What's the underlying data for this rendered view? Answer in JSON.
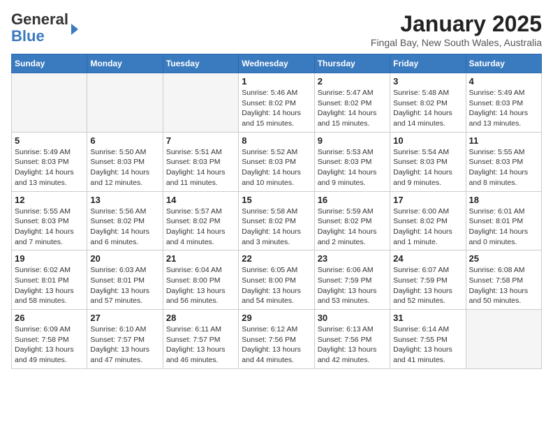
{
  "header": {
    "logo_line1": "General",
    "logo_line2": "Blue",
    "month_title": "January 2025",
    "location": "Fingal Bay, New South Wales, Australia"
  },
  "calendar": {
    "days_of_week": [
      "Sunday",
      "Monday",
      "Tuesday",
      "Wednesday",
      "Thursday",
      "Friday",
      "Saturday"
    ],
    "weeks": [
      [
        {
          "day": "",
          "info": ""
        },
        {
          "day": "",
          "info": ""
        },
        {
          "day": "",
          "info": ""
        },
        {
          "day": "1",
          "info": "Sunrise: 5:46 AM\nSunset: 8:02 PM\nDaylight: 14 hours\nand 15 minutes."
        },
        {
          "day": "2",
          "info": "Sunrise: 5:47 AM\nSunset: 8:02 PM\nDaylight: 14 hours\nand 15 minutes."
        },
        {
          "day": "3",
          "info": "Sunrise: 5:48 AM\nSunset: 8:02 PM\nDaylight: 14 hours\nand 14 minutes."
        },
        {
          "day": "4",
          "info": "Sunrise: 5:49 AM\nSunset: 8:03 PM\nDaylight: 14 hours\nand 13 minutes."
        }
      ],
      [
        {
          "day": "5",
          "info": "Sunrise: 5:49 AM\nSunset: 8:03 PM\nDaylight: 14 hours\nand 13 minutes."
        },
        {
          "day": "6",
          "info": "Sunrise: 5:50 AM\nSunset: 8:03 PM\nDaylight: 14 hours\nand 12 minutes."
        },
        {
          "day": "7",
          "info": "Sunrise: 5:51 AM\nSunset: 8:03 PM\nDaylight: 14 hours\nand 11 minutes."
        },
        {
          "day": "8",
          "info": "Sunrise: 5:52 AM\nSunset: 8:03 PM\nDaylight: 14 hours\nand 10 minutes."
        },
        {
          "day": "9",
          "info": "Sunrise: 5:53 AM\nSunset: 8:03 PM\nDaylight: 14 hours\nand 9 minutes."
        },
        {
          "day": "10",
          "info": "Sunrise: 5:54 AM\nSunset: 8:03 PM\nDaylight: 14 hours\nand 9 minutes."
        },
        {
          "day": "11",
          "info": "Sunrise: 5:55 AM\nSunset: 8:03 PM\nDaylight: 14 hours\nand 8 minutes."
        }
      ],
      [
        {
          "day": "12",
          "info": "Sunrise: 5:55 AM\nSunset: 8:03 PM\nDaylight: 14 hours\nand 7 minutes."
        },
        {
          "day": "13",
          "info": "Sunrise: 5:56 AM\nSunset: 8:02 PM\nDaylight: 14 hours\nand 6 minutes."
        },
        {
          "day": "14",
          "info": "Sunrise: 5:57 AM\nSunset: 8:02 PM\nDaylight: 14 hours\nand 4 minutes."
        },
        {
          "day": "15",
          "info": "Sunrise: 5:58 AM\nSunset: 8:02 PM\nDaylight: 14 hours\nand 3 minutes."
        },
        {
          "day": "16",
          "info": "Sunrise: 5:59 AM\nSunset: 8:02 PM\nDaylight: 14 hours\nand 2 minutes."
        },
        {
          "day": "17",
          "info": "Sunrise: 6:00 AM\nSunset: 8:02 PM\nDaylight: 14 hours\nand 1 minute."
        },
        {
          "day": "18",
          "info": "Sunrise: 6:01 AM\nSunset: 8:01 PM\nDaylight: 14 hours\nand 0 minutes."
        }
      ],
      [
        {
          "day": "19",
          "info": "Sunrise: 6:02 AM\nSunset: 8:01 PM\nDaylight: 13 hours\nand 58 minutes."
        },
        {
          "day": "20",
          "info": "Sunrise: 6:03 AM\nSunset: 8:01 PM\nDaylight: 13 hours\nand 57 minutes."
        },
        {
          "day": "21",
          "info": "Sunrise: 6:04 AM\nSunset: 8:00 PM\nDaylight: 13 hours\nand 56 minutes."
        },
        {
          "day": "22",
          "info": "Sunrise: 6:05 AM\nSunset: 8:00 PM\nDaylight: 13 hours\nand 54 minutes."
        },
        {
          "day": "23",
          "info": "Sunrise: 6:06 AM\nSunset: 7:59 PM\nDaylight: 13 hours\nand 53 minutes."
        },
        {
          "day": "24",
          "info": "Sunrise: 6:07 AM\nSunset: 7:59 PM\nDaylight: 13 hours\nand 52 minutes."
        },
        {
          "day": "25",
          "info": "Sunrise: 6:08 AM\nSunset: 7:58 PM\nDaylight: 13 hours\nand 50 minutes."
        }
      ],
      [
        {
          "day": "26",
          "info": "Sunrise: 6:09 AM\nSunset: 7:58 PM\nDaylight: 13 hours\nand 49 minutes."
        },
        {
          "day": "27",
          "info": "Sunrise: 6:10 AM\nSunset: 7:57 PM\nDaylight: 13 hours\nand 47 minutes."
        },
        {
          "day": "28",
          "info": "Sunrise: 6:11 AM\nSunset: 7:57 PM\nDaylight: 13 hours\nand 46 minutes."
        },
        {
          "day": "29",
          "info": "Sunrise: 6:12 AM\nSunset: 7:56 PM\nDaylight: 13 hours\nand 44 minutes."
        },
        {
          "day": "30",
          "info": "Sunrise: 6:13 AM\nSunset: 7:56 PM\nDaylight: 13 hours\nand 42 minutes."
        },
        {
          "day": "31",
          "info": "Sunrise: 6:14 AM\nSunset: 7:55 PM\nDaylight: 13 hours\nand 41 minutes."
        },
        {
          "day": "",
          "info": ""
        }
      ]
    ]
  }
}
